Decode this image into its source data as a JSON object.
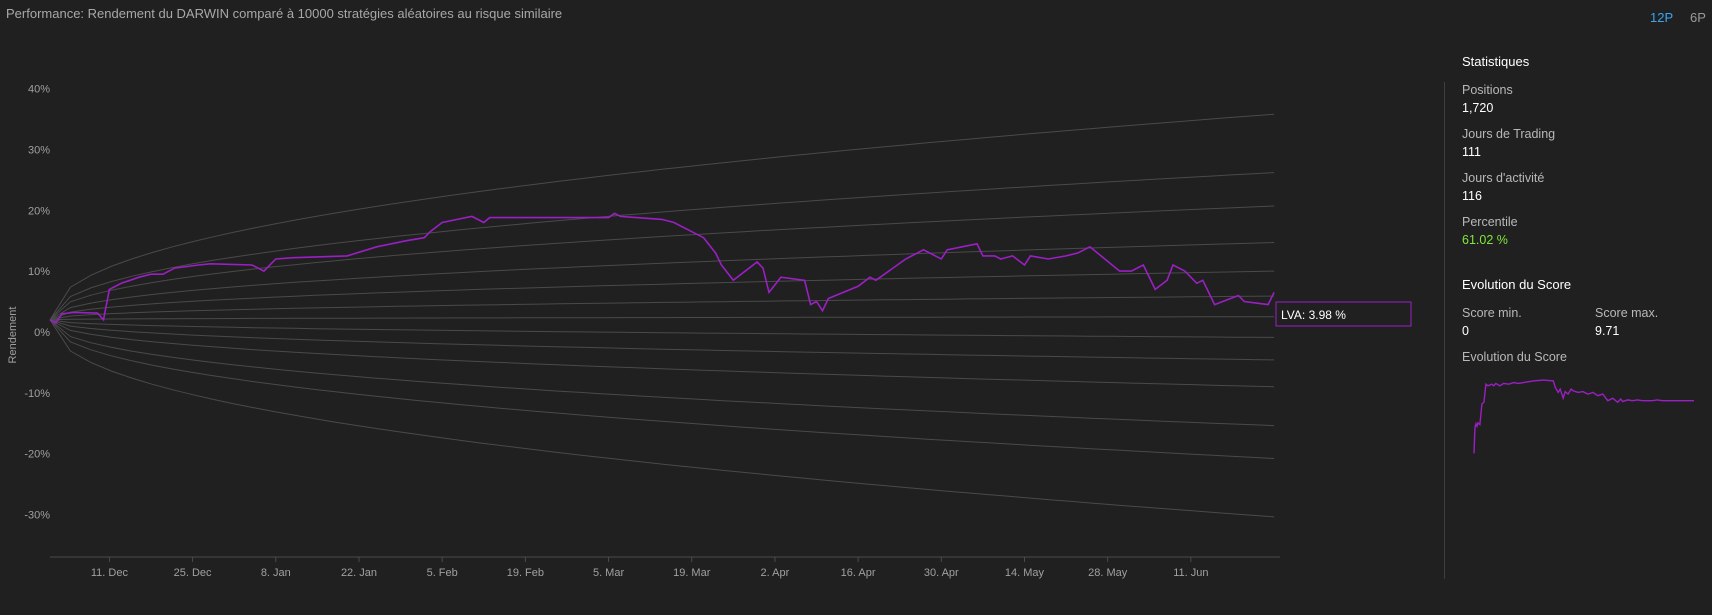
{
  "title": "Performance: Rendement du DARWIN comparé à 10000 stratégies aléatoires au risque similaire",
  "period_buttons": [
    {
      "label": "12P",
      "active": true
    },
    {
      "label": "6P",
      "active": false
    }
  ],
  "colors": {
    "background": "#202020",
    "darwin_line": "#9b1fc4",
    "band_lines": "#4a4a4a",
    "active_button": "#3ba3f0",
    "percentile": "#7de83a"
  },
  "chart_data": {
    "type": "line",
    "ylabel": "Rendement",
    "ylim": [
      -37,
      48
    ],
    "yticks": [
      40,
      30,
      20,
      10,
      0,
      -10,
      -20,
      -30
    ],
    "ytick_labels": [
      "40%",
      "30%",
      "20%",
      "10%",
      "0%",
      "-10%",
      "-20%",
      "-30%"
    ],
    "xlim": [
      "2017-12-01",
      "2018-06-26"
    ],
    "xticks": [
      "2017-12-11",
      "2017-12-25",
      "2018-01-08",
      "2018-01-22",
      "2018-02-05",
      "2018-02-19",
      "2018-03-05",
      "2018-03-19",
      "2018-04-02",
      "2018-04-16",
      "2018-04-30",
      "2018-05-14",
      "2018-05-28",
      "2018-06-11"
    ],
    "xtick_labels": [
      "11. Dec",
      "25. Dec",
      "8. Jan",
      "22. Jan",
      "5. Feb",
      "19. Feb",
      "5. Mar",
      "19. Mar",
      "2. Apr",
      "16. Apr",
      "30. Apr",
      "14. May",
      "28. May",
      "11. Jun"
    ],
    "band_end_dates": [
      "2018-06-25",
      "2018-06-25",
      "2018-06-25",
      "2018-06-25",
      "2018-06-25",
      "2018-06-25",
      "2018-06-25",
      "2018-06-25",
      "2018-06-25",
      "2018-06-25",
      "2018-06-25",
      "2018-06-25"
    ],
    "band_end_values": [
      35.8,
      26.2,
      20.7,
      14.7,
      10.0,
      5.9,
      2.5,
      -0.9,
      -4.6,
      -9.0,
      -15.4,
      -20.8,
      -30.4
    ],
    "series": [
      {
        "name": "LVA",
        "label": "LVA: 3.98 %",
        "x": [
          "2017-12-01",
          "2017-12-02",
          "2017-12-03",
          "2017-12-05",
          "2017-12-09",
          "2017-12-10",
          "2017-12-11",
          "2017-12-13",
          "2017-12-16",
          "2017-12-18",
          "2017-12-20",
          "2017-12-22",
          "2017-12-26",
          "2017-12-28",
          "2018-01-04",
          "2018-01-06",
          "2018-01-08",
          "2018-01-11",
          "2018-01-20",
          "2018-01-25",
          "2018-01-30",
          "2018-02-02",
          "2018-02-03",
          "2018-02-05",
          "2018-02-10",
          "2018-02-12",
          "2018-02-13",
          "2018-03-05",
          "2018-03-06",
          "2018-03-07",
          "2018-03-14",
          "2018-03-16",
          "2018-03-21",
          "2018-03-23",
          "2018-03-24",
          "2018-03-26",
          "2018-03-30",
          "2018-03-31",
          "2018-04-01",
          "2018-04-03",
          "2018-04-07",
          "2018-04-08",
          "2018-04-09",
          "2018-04-10",
          "2018-04-11",
          "2018-04-16",
          "2018-04-18",
          "2018-04-19",
          "2018-04-24",
          "2018-04-26",
          "2018-04-27",
          "2018-04-30",
          "2018-05-01",
          "2018-05-06",
          "2018-05-07",
          "2018-05-09",
          "2018-05-10",
          "2018-05-12",
          "2018-05-14",
          "2018-05-15",
          "2018-05-18",
          "2018-05-21",
          "2018-05-23",
          "2018-05-25",
          "2018-05-30",
          "2018-06-01",
          "2018-06-03",
          "2018-06-05",
          "2018-06-07",
          "2018-06-08",
          "2018-06-10",
          "2018-06-12",
          "2018-06-13",
          "2018-06-15",
          "2018-06-19",
          "2018-06-20",
          "2018-06-24",
          "2018-06-25"
        ],
        "y": [
          2.0,
          1.5,
          3.0,
          3.2,
          3.1,
          2.0,
          7.0,
          8.0,
          9.0,
          9.5,
          9.5,
          10.5,
          11.0,
          11.2,
          11.0,
          10.0,
          12.0,
          12.2,
          12.5,
          14.0,
          15.0,
          15.5,
          16.5,
          18.0,
          19.0,
          18.0,
          18.8,
          18.8,
          19.5,
          19.0,
          18.5,
          18.0,
          15.5,
          13.0,
          11.0,
          8.5,
          11.5,
          10.5,
          6.5,
          9.0,
          8.5,
          4.5,
          5.0,
          3.5,
          5.5,
          7.5,
          9.0,
          8.5,
          12.0,
          13.0,
          13.5,
          12.0,
          13.5,
          14.5,
          12.5,
          12.5,
          12.0,
          12.5,
          11.0,
          12.5,
          12.0,
          12.5,
          13.0,
          14.0,
          10.0,
          10.0,
          11.0,
          7.0,
          8.5,
          11.0,
          10.0,
          8.0,
          8.5,
          4.5,
          6.0,
          5.0,
          4.5,
          6.5
        ]
      }
    ]
  },
  "stats": {
    "heading": "Statistiques",
    "items": [
      {
        "label": "Positions",
        "value": "1,720"
      },
      {
        "label": "Jours de Trading",
        "value": "111"
      },
      {
        "label": "Jours d'activité",
        "value": "116"
      },
      {
        "label": "Percentile",
        "value": "61.02 %"
      }
    ]
  },
  "score": {
    "heading": "Evolution du Score",
    "min_label": "Score min.",
    "min_value": "0",
    "max_label": "Score max.",
    "max_value": "9.71",
    "chart_label": "Evolution du Score",
    "mini_chart": {
      "type": "line",
      "ylim": [
        0,
        9.71
      ],
      "x": [
        0,
        0.5,
        1,
        2,
        3,
        4,
        6,
        8,
        10,
        12,
        14,
        18,
        20,
        22,
        26,
        30,
        35,
        40,
        45,
        50,
        55,
        60,
        70,
        80,
        82,
        85,
        87,
        90,
        92,
        95,
        98,
        100,
        105,
        110,
        115,
        120,
        125,
        130,
        135,
        140,
        145,
        148,
        150,
        155,
        160,
        165,
        170,
        175,
        180,
        185,
        190,
        195,
        200,
        205,
        210,
        215,
        220,
        222
      ],
      "y": [
        0.8,
        2.5,
        4.0,
        4.4,
        4.1,
        4.5,
        4.3,
        6.8,
        7.0,
        9.2,
        9.0,
        9.2,
        9.0,
        9.3,
        9.0,
        9.3,
        9.2,
        9.4,
        9.3,
        9.4,
        9.5,
        9.6,
        9.7,
        9.6,
        8.8,
        8.2,
        8.6,
        7.5,
        8.3,
        8.0,
        8.6,
        8.4,
        8.2,
        8.3,
        8.0,
        8.2,
        7.8,
        8.0,
        7.2,
        7.5,
        7.0,
        7.4,
        7.1,
        7.3,
        7.2,
        7.3,
        7.2,
        7.2,
        7.2,
        7.3,
        7.2,
        7.2,
        7.2,
        7.2,
        7.2,
        7.2,
        7.2,
        7.2
      ]
    }
  }
}
